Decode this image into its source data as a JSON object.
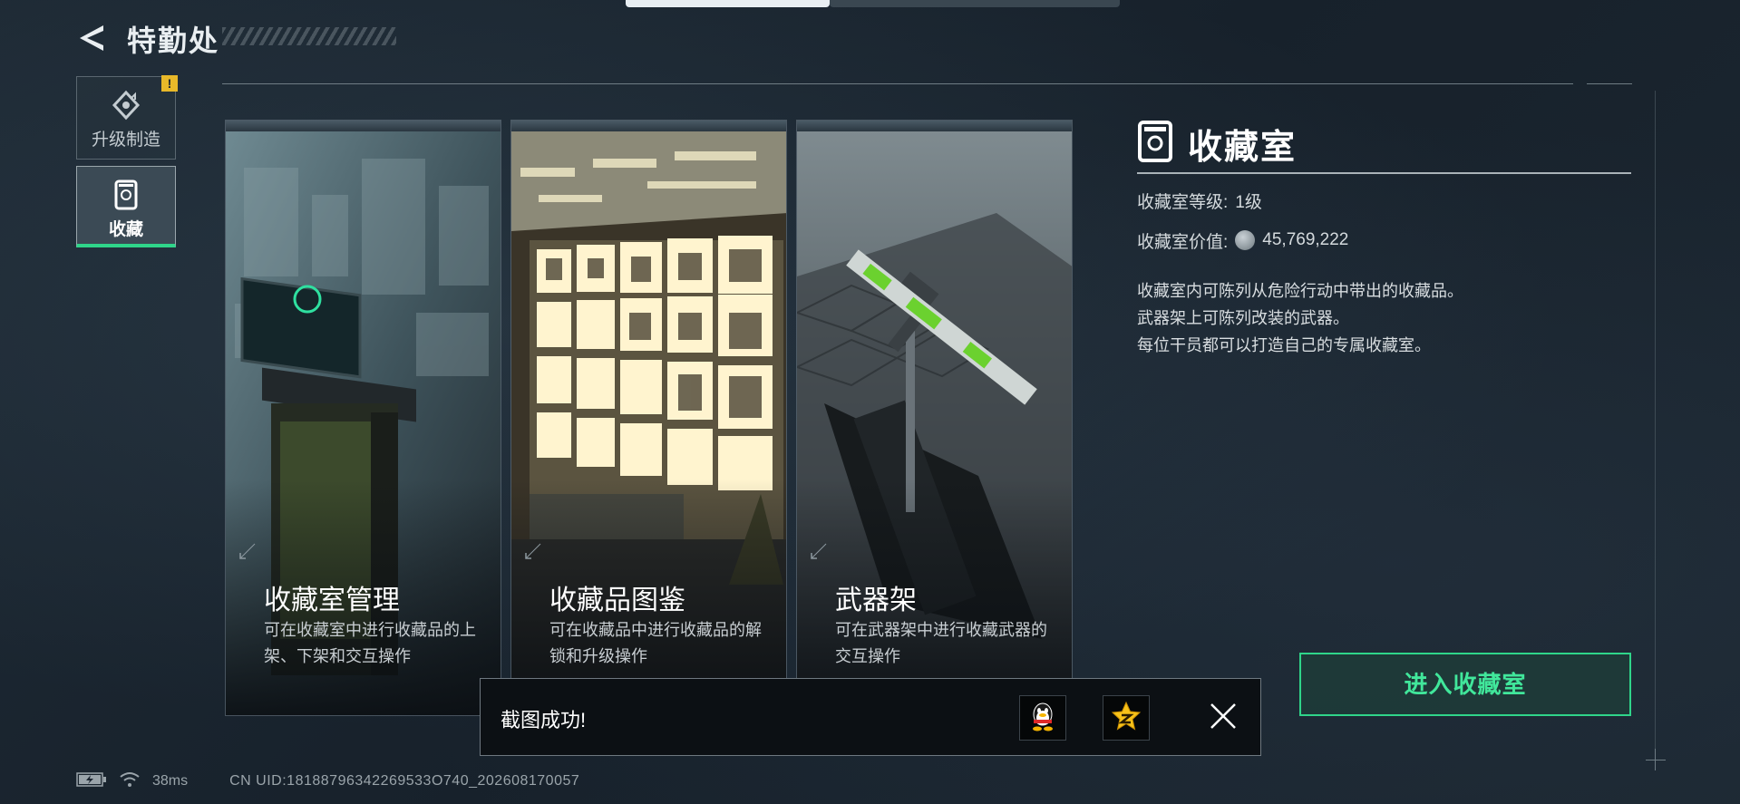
{
  "header": {
    "title": "特勤处"
  },
  "sidebar": {
    "items": [
      {
        "label": "升级制造",
        "badge": "!",
        "active": false
      },
      {
        "label": "收藏",
        "active": true
      }
    ]
  },
  "cards": [
    {
      "title": "收藏室管理",
      "desc": "可在收藏室中进行收藏品的上架、下架和交互操作"
    },
    {
      "title": "收藏品图鉴",
      "desc": "可在收藏品中进行收藏品的解锁和升级操作"
    },
    {
      "title": "武器架",
      "desc": "可在武器架中进行收藏武器的交互操作"
    }
  ],
  "info": {
    "title": "收藏室",
    "level_label": "收藏室等级:",
    "level_value": "1级",
    "value_label": "收藏室价值:",
    "value_amount": "45,769,222",
    "desc_lines": [
      "收藏室内可陈列从危险行动中带出的收藏品。",
      "武器架上可陈列改装的武器。",
      "每位干员都可以打造自己的专属收藏室。"
    ],
    "enter_button": "进入收藏室"
  },
  "toast": {
    "message": "截图成功!"
  },
  "status": {
    "ping": "38ms",
    "uid": "CN UID:18188796342269533O740_202608170057"
  },
  "colors": {
    "accent_green": "#2fd58a",
    "warning_yellow": "#e8b829",
    "background": "#1b2530"
  }
}
